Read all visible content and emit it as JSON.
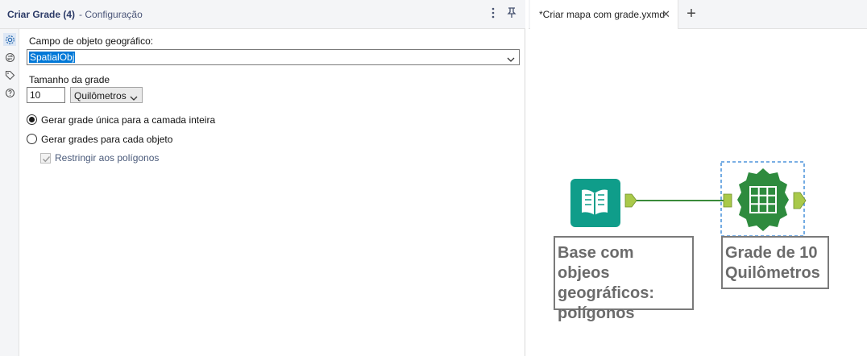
{
  "config_panel": {
    "title": "Criar Grade (4)",
    "subtitle": "- Configuração",
    "menu_icon": "kebab-icon",
    "pin_icon": "pin-icon",
    "rail_icons": [
      "gear-icon",
      "settings-arrows-icon",
      "tag-icon",
      "help-icon"
    ],
    "spatial_field_label": "Campo de objeto geográfico:",
    "spatial_field_value": "SpatialObj",
    "grid_size_label": "Tamanho da grade",
    "grid_size_value": "10",
    "grid_unit_value": "Quilômetros",
    "radio_single_label": "Gerar grade única para a camada inteira",
    "radio_single_checked": true,
    "radio_each_label": "Gerar grades para cada objeto",
    "radio_each_checked": false,
    "restrict_label": "Restringir aos polígonos",
    "restrict_checked": true,
    "restrict_disabled": true
  },
  "workflow": {
    "tab_label": "*Criar mapa com grade.yxmd",
    "tab_close_icon": "close-icon",
    "add_tab_icon": "plus-icon",
    "input_tool_icon": "book-icon",
    "grid_tool_icon": "grid-icon",
    "input_annotation": [
      "Base com objeos",
      "geográficos:",
      "polígonos"
    ],
    "grid_annotation": [
      "Grade de 10",
      "Quilômetros"
    ]
  },
  "colors": {
    "accent_blue": "#0078d7",
    "input_tool": "#0f9d8a",
    "grid_tool": "#2e8b3e",
    "connector": "#a9c94a",
    "connection_line": "#3a8a3a",
    "selection_dash": "#2a7fd4"
  }
}
